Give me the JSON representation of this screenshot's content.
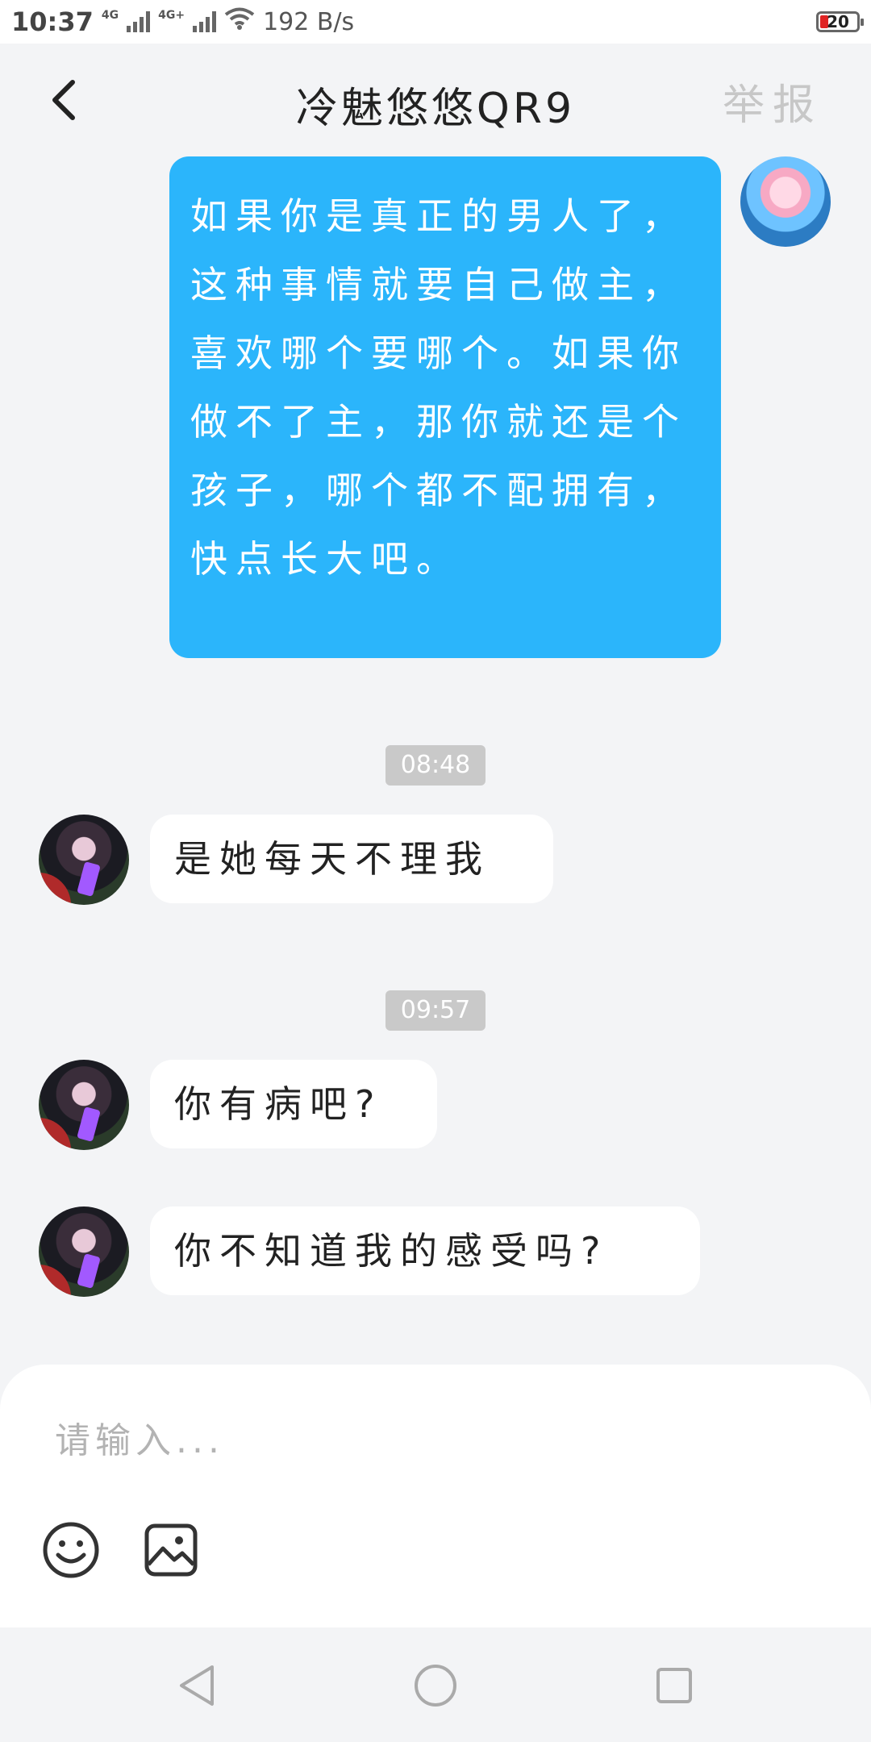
{
  "status": {
    "time": "10:37",
    "network1": "4G",
    "network2": "4G+",
    "speed": "192 B/s",
    "battery": "20"
  },
  "header": {
    "title": "冷魅悠悠QR9",
    "report": "举报"
  },
  "messages": {
    "outgoing_1": "如果你是真正的男人了，这种事情就要自己做主，喜欢哪个要哪个。如果你做不了主，那你就还是个孩子，哪个都不配拥有，快点长大吧。",
    "time_1": "08:48",
    "incoming_1": "是她每天不理我",
    "time_2": "09:57",
    "incoming_2": "你有病吧?",
    "incoming_3": "你不知道我的感受吗?"
  },
  "input": {
    "placeholder": "请输入..."
  },
  "icons": {
    "back": "chevron-left-icon",
    "emoji": "smiley-icon",
    "image": "image-icon",
    "nav_back": "triangle-back-icon",
    "nav_home": "circle-home-icon",
    "nav_recent": "square-recent-icon"
  },
  "colors": {
    "outgoing_bubble": "#2bb5fb",
    "background": "#f3f4f6",
    "time_pill": "#c9c9c9"
  }
}
